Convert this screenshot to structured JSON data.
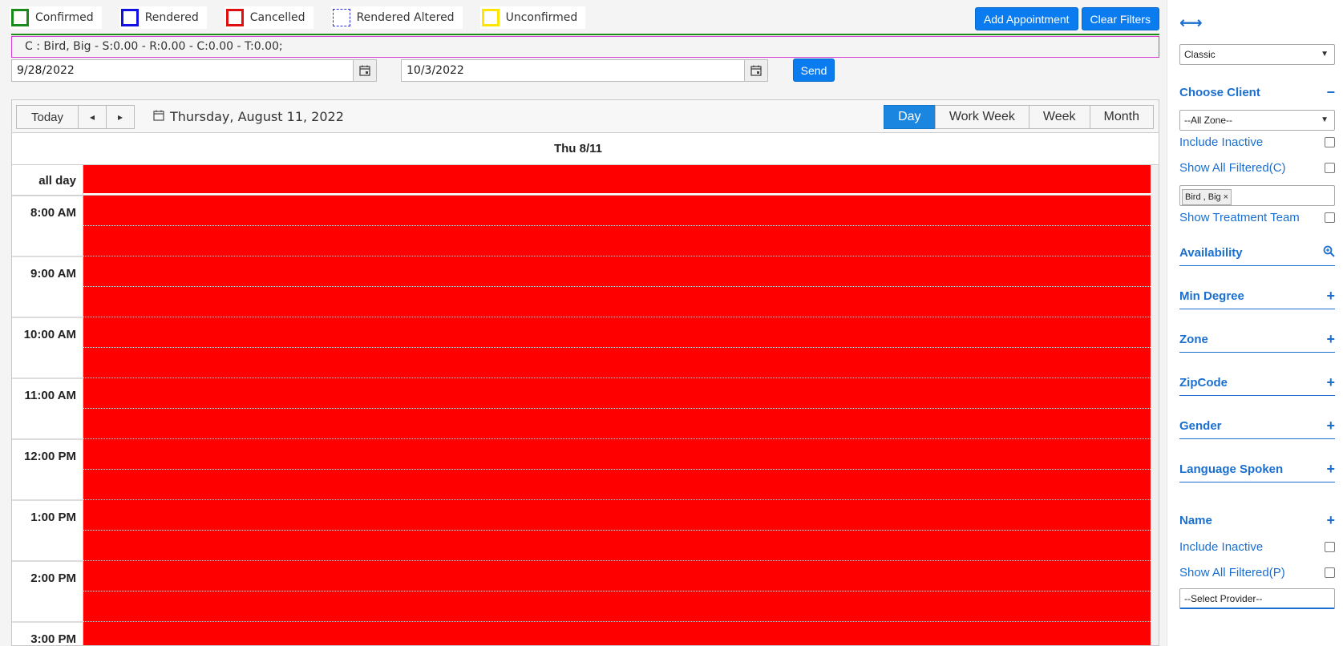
{
  "legend": [
    {
      "label": "Confirmed",
      "color": "#1a8a1a",
      "style": "solid"
    },
    {
      "label": "Rendered",
      "color": "#1010e0",
      "style": "solid"
    },
    {
      "label": "Cancelled",
      "color": "#e01010",
      "style": "solid"
    },
    {
      "label": "Rendered Altered",
      "color": "#2a2ad8",
      "style": "dotted"
    },
    {
      "label": "Unconfirmed",
      "color": "#ffe600",
      "style": "solid"
    }
  ],
  "toolbar": {
    "add_appointment": "Add Appointment",
    "clear_filters": "Clear Filters"
  },
  "summary": "C : Bird, Big - S:0.00 - R:0.00 - C:0.00 - T:0.00;",
  "date_range": {
    "start": "9/28/2022",
    "end": "10/3/2022",
    "send_label": "Send"
  },
  "calendar": {
    "today_label": "Today",
    "prev_icon": "◂",
    "next_icon": "▸",
    "current_date": "Thursday, August 11, 2022",
    "views": [
      "Day",
      "Work Week",
      "Week",
      "Month"
    ],
    "active_view": "Day",
    "day_header": "Thu 8/11",
    "all_day_label": "all day",
    "event_color": "#ff0000",
    "hours": [
      "8:00 AM",
      "9:00 AM",
      "10:00 AM",
      "11:00 AM",
      "12:00 PM",
      "1:00 PM",
      "2:00 PM",
      "3:00 PM"
    ]
  },
  "sidebar": {
    "expand_icon": "⟷",
    "template_select": "Classic",
    "choose_client": "Choose Client",
    "choose_client_toggle": "−",
    "zone_select": "--All Zone--",
    "include_inactive_c": "Include Inactive",
    "show_all_filtered_c": "Show All Filtered(C)",
    "selected_client_tag": "Bird , Big",
    "show_treatment_team": "Show Treatment Team",
    "availability": "Availability",
    "availability_icon": "magnify-icon",
    "filters": [
      "Min Degree",
      "Zone",
      "ZipCode",
      "Gender",
      "Language Spoken"
    ],
    "name_label": "Name",
    "include_inactive_p": "Include Inactive",
    "show_all_filtered_p": "Show All Filtered(P)",
    "provider_select": "--Select Provider--",
    "plus_icon": "+"
  }
}
